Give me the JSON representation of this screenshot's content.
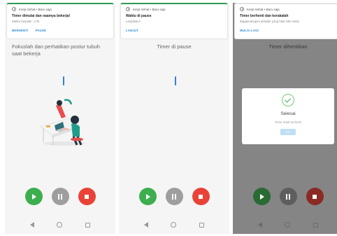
{
  "accent": "#2e9a52",
  "link_color": "#2a8ad8",
  "screens": [
    {
      "notification": {
        "app": "Kerja Sehat • Baru saja",
        "title": "Timer dimulai dan naamya bekerja!",
        "subtitle": "Waktu berjalan: 1:00",
        "actions": [
          "BERHENTI",
          "PAUSE"
        ]
      },
      "title": "Fokuslah dan perhatikan postur tubuh saat bekerja",
      "controls": [
        "play-icon",
        "pause-icon",
        "stop-icon"
      ]
    },
    {
      "notification": {
        "app": "Kerja Sehat • Baru saja",
        "title": "Waktu di pause",
        "subtitle": "Lanjutkan?",
        "actions": [
          "LANJUT"
        ]
      },
      "title": "Timer di pause",
      "controls": [
        "play-icon",
        "pause-icon",
        "stop-icon"
      ]
    },
    {
      "notification": {
        "app": "Kerja Sehat • Baru saja",
        "title": "Timer berhenti dan kerakalah",
        "subtitle": "Bagaimanapun jelaslah yang baik hide statis",
        "actions": [
          "MULAI LAGI"
        ]
      },
      "title": "Timer dihentikan",
      "dialog": {
        "title": "Selesai",
        "message": "Timer telah berhenti",
        "ok_label": "OK"
      },
      "controls": [
        "play-icon",
        "pause-icon",
        "stop-icon"
      ]
    }
  ]
}
